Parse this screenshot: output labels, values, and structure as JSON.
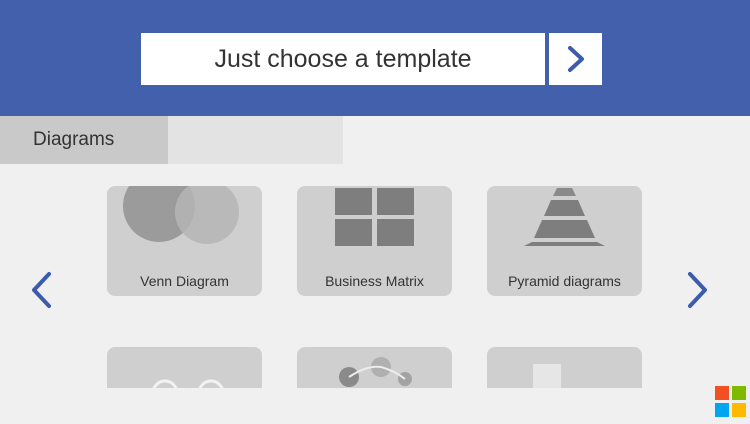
{
  "header": {
    "title": "Just choose a template",
    "next_icon": "chevron-right-icon",
    "background": "#4360ad"
  },
  "tabs": {
    "active_label": "Diagrams"
  },
  "templates": [
    {
      "label": "Venn Diagram",
      "icon": "venn-diagram-icon"
    },
    {
      "label": "Business Matrix",
      "icon": "business-matrix-icon"
    },
    {
      "label": "Pyramid diagrams",
      "icon": "pyramid-icon"
    }
  ],
  "navigation": {
    "prev_icon": "chevron-left-icon",
    "next_icon": "chevron-right-icon",
    "accent": "#3c5bab"
  },
  "branding": {
    "logo": "microsoft-logo-icon",
    "colors": [
      "#f25022",
      "#7fba00",
      "#00a4ef",
      "#ffb900"
    ]
  }
}
